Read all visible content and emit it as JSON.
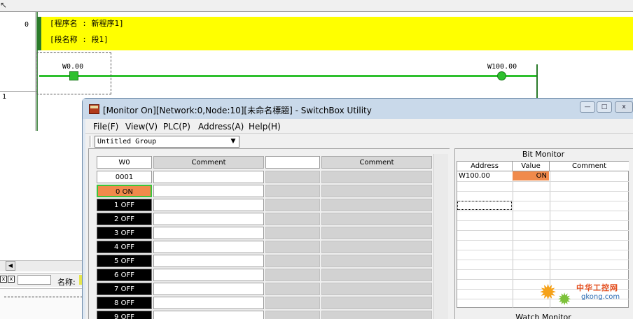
{
  "ladder": {
    "rung0_number": "0",
    "rung1_number": "1",
    "program_name_line": "[程序名 : 新程序1]",
    "section_name_line": "[段名称 : 段1]",
    "contact_address": "W0.00",
    "coil_address": "W100.00",
    "name_label": "名称:",
    "scroll_left_glyph": "◀",
    "close_glyph": "x"
  },
  "window": {
    "title": "[Monitor On][Network:0,Node:10][未命名標題] - SwitchBox Utility",
    "minimize_glyph": "—",
    "maximize_glyph": "□",
    "close_glyph": "x"
  },
  "menu": {
    "file": "File(F)",
    "view": "View(V)",
    "plc": "PLC(P)",
    "address": "Address(A)",
    "help": "Help(H)"
  },
  "toolbar": {
    "group_value": "Untitled Group",
    "dropdown_glyph": "▼"
  },
  "word_grid": {
    "word_header": "W0",
    "comment_header": "Comment",
    "comment_header_2": "Comment",
    "hex_value": "0001",
    "bits": [
      "0   ON",
      "1   OFF",
      "2   OFF",
      "3   OFF",
      "4   OFF",
      "5   OFF",
      "6   OFF",
      "7   OFF",
      "8   OFF",
      "9   OFF"
    ]
  },
  "bit_monitor": {
    "title": "Bit Monitor",
    "col_address": "Address",
    "col_value": "Value",
    "col_comment": "Comment",
    "row_address": "W100.00",
    "row_value": "ON"
  },
  "watch_monitor": {
    "title": "Watch Monitor"
  },
  "watermark": {
    "cn": "中华工控网",
    "en": "gkong.com"
  },
  "colors": {
    "comment_yellow": "#ffff00",
    "energized_green": "#2ec02e",
    "bit_on_orange": "#f08a4b",
    "bit_off_black": "#000000"
  }
}
